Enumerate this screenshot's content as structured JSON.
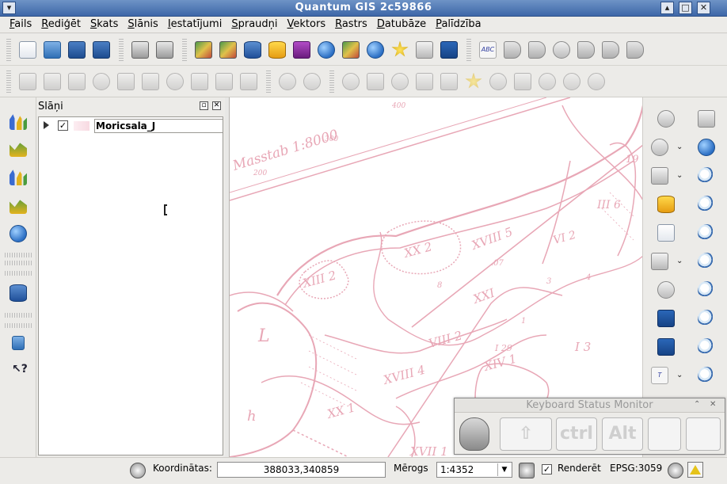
{
  "window": {
    "title": "Quantum GIS 2c59866"
  },
  "menubar": {
    "items": [
      "Fails",
      "Rediģēt",
      "Skats",
      "Slānis",
      "Iestatījumi",
      "Spraudņi",
      "Vektors",
      "Rastrs",
      "Datubāze",
      "Palīdzība"
    ]
  },
  "toolbar1": {
    "icons": [
      "new-project-icon",
      "open-project-icon",
      "save-project-icon",
      "save-as-icon",
      "print-composer-icon",
      "print-icon",
      "add-raster-layer-icon",
      "add-wms-layer-icon",
      "add-spatialite-layer-icon",
      "add-postgis-layer-icon",
      "add-mssql-layer-icon",
      "add-wfs-layer-icon",
      "add-delimited-text-icon",
      "add-gpx-icon",
      "new-bookmark-icon",
      "remove-layer-icon",
      "save-edits-icon",
      "label-abc-icon",
      "label-tool-icon",
      "pin-label-icon",
      "show-hide-label-icon",
      "move-label-icon",
      "rotate-label-icon",
      "change-label-icon"
    ]
  },
  "toolbar2": {
    "icons": [
      "save-layer-edits-icon",
      "toggle-editing-icon",
      "save-disabled-icon",
      "add-feature-icon",
      "move-feature-icon",
      "node-tool-icon",
      "delete-selected-icon",
      "cut-features-icon",
      "copy-features-icon",
      "paste-features-icon",
      "undo-icon",
      "redo-icon",
      "simplify-feature-icon",
      "add-ring-icon",
      "add-part-icon",
      "delete-ring-icon",
      "delete-part-icon",
      "reshape-features-icon",
      "offset-curve-icon",
      "split-features-icon",
      "merge-features-icon",
      "merge-attributes-icon",
      "rotate-point-symbols-icon"
    ]
  },
  "left_toolbar": {
    "icons": [
      "add-raster-icon",
      "add-vector-icon",
      "histogram-icon",
      "layer-properties-icon",
      "wms-globe-icon",
      "database-icon",
      "help-book-icon",
      "whats-this-icon"
    ]
  },
  "layers_panel": {
    "title": "Slāņi",
    "layers": [
      {
        "name": "Moricsala_J",
        "checked": true
      }
    ]
  },
  "right_toolbar": {
    "icons": [
      "identify-icon",
      "pan-icon",
      "settings-gear-icon",
      "pan-to-selection-icon",
      "select-icon",
      "zoom-in-icon",
      "deselect-icon",
      "zoom-out-icon",
      "attribute-table-icon",
      "zoom-full-icon",
      "measure-icon",
      "zoom-to-layer-icon",
      "annotation-icon",
      "zoom-to-selection-icon",
      "map-tips-icon",
      "zoom-actual-icon",
      "new-bookmark-icon",
      "zoom-last-icon",
      "show-bookmarks-icon",
      "zoom-next-icon",
      "text-annotation-icon",
      "refresh-icon"
    ]
  },
  "keyboard_monitor": {
    "title": "Keyboard Status Monitor",
    "keys": [
      "ctrl",
      "Alt"
    ]
  },
  "statusbar": {
    "coord_label": "Koordinātas:",
    "coord_value": "388033,340859",
    "scale_label": "Mērogs",
    "scale_value": "1:4352",
    "render_label": "Renderēt",
    "render_checked": true,
    "crs": "EPSG:3059"
  },
  "map": {
    "scale_text": "Masstab 1:8000",
    "labels": [
      "400",
      "300",
      "200",
      "XVIII 5",
      "XX 2",
      "XIII 2",
      "VI 2",
      "III 6",
      "XXI",
      "XIV 1",
      "XVIII 4",
      "VIII 2",
      "XX 1",
      "XVII 1",
      "I 3",
      "I 29",
      "L",
      "h",
      "19",
      ".07",
      "8",
      "4",
      "3",
      "1"
    ],
    "line_color": "#e8a7b6"
  }
}
